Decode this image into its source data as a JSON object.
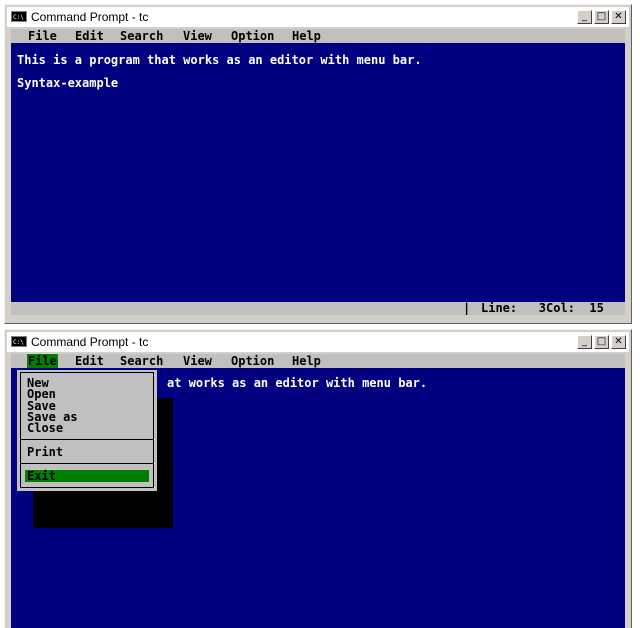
{
  "windows": [
    {
      "title": "Command Prompt - tc",
      "icon_text": "C:\\",
      "buttons": {
        "minimize": "_",
        "maximize": "□",
        "close": "✕"
      },
      "menu": [
        "File",
        "Edit",
        "Search",
        "View",
        "Option",
        "Help"
      ],
      "lines": [
        "This is a program that works as an editor with menu bar.",
        "Syntax-example"
      ],
      "status": {
        "separator": "|",
        "text": "Line:   3Col:  15"
      }
    },
    {
      "title": "Command Prompt - tc",
      "icon_text": "C:\\",
      "buttons": {
        "minimize": "_",
        "maximize": "□",
        "close": "✕"
      },
      "menu": [
        "File",
        "Edit",
        "Search",
        "View",
        "Option",
        "Help"
      ],
      "visible_line": "at works as an editor with menu bar.",
      "dropdown": {
        "items": [
          "New",
          "Open",
          "Save",
          "Save as",
          "Close"
        ],
        "print": "Print",
        "exit": "Exit"
      }
    }
  ],
  "colors": {
    "console_bg": "#000080",
    "menu_bg": "#c0c0c0",
    "highlight": "#008000",
    "text": "#ffffff"
  }
}
